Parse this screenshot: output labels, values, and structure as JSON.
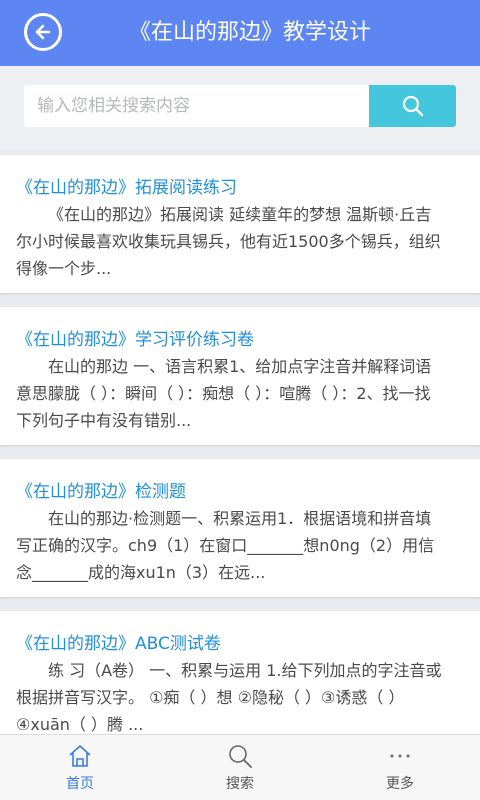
{
  "header": {
    "title": "《在山的那边》教学设计",
    "back_icon": "back-arrow-icon",
    "color": "#5d86f2"
  },
  "search": {
    "placeholder": "输入您相关搜索内容",
    "value": "",
    "button_icon": "search-icon",
    "button_color": "#44c6dc"
  },
  "results": [
    {
      "title": "《在山的那边》拓展阅读练习",
      "desc": "《在山的那边》拓展阅读 延续童年的梦想 温斯顿·丘吉尔小时候最喜欢收集玩具锡兵，他有近1500多个锡兵，组织得像一个步..."
    },
    {
      "title": "《在山的那边》学习评价练习卷",
      "desc": "在山的那边 一、语言积累1、给加点字注音并解释词语意思朦胧（ ）：瞬间（ ）：痴想（ ）：喧腾（ ）：2、找一找下列句子中有没有错别..."
    },
    {
      "title": "《在山的那边》检测题",
      "desc": "在山的那边·检测题一、积累运用1．根据语境和拼音填写正确的汉字。ch9（1）在窗口_______想n0ng（2）用信念_______成的海xu1n（3）在远..."
    },
    {
      "title": "《在山的那边》ABC测试卷",
      "desc": "练 习（A卷） 一、积累与运用 1.给下列加点的字注音或根据拼音写汉字。 ①痴（ ）想 ②隐秘（ ）③诱惑（ ）④xuān（ ）腾 ..."
    }
  ],
  "nav": [
    {
      "label": "首页",
      "icon": "home-icon",
      "active": true
    },
    {
      "label": "搜索",
      "icon": "search-icon",
      "active": false
    },
    {
      "label": "更多",
      "icon": "more-icon",
      "active": false
    }
  ]
}
